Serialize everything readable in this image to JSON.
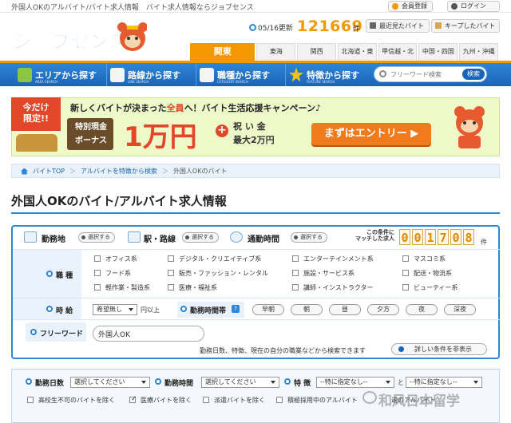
{
  "topbar": {
    "text": "外国人OKのアルバイト/バイト求人情報　バイト求人情報ならジョブセンス",
    "member_register": "会員登録",
    "login": "ログイン"
  },
  "header": {
    "logo_text": "ジョブセンス",
    "update_date": "05/16更新",
    "job_count": "121669",
    "job_count_unit": "件",
    "recent_button": "最近見たバイト",
    "keep_button": "キープしたバイト"
  },
  "regions": [
    "関東",
    "東海",
    "関西",
    "北海道・東北",
    "甲信越・北陸",
    "中国・四国",
    "九州・沖縄"
  ],
  "nav": [
    {
      "label": "エリアから探す",
      "sub": "AREA SEARCH"
    },
    {
      "label": "路線から探す",
      "sub": "LINE SEARCH"
    },
    {
      "label": "職種から探す",
      "sub": "CATEGORY SEARCH"
    },
    {
      "label": "特徴から探す",
      "sub": "FEATURE SEARCH"
    }
  ],
  "search": {
    "placeholder": "フリーワード検索",
    "button": "検索"
  },
  "banner": {
    "badge_line1": "今だけ",
    "badge_line2": "限定!!",
    "title_prefix": "新しくバイトが決まった",
    "title_highlight": "全員",
    "title_suffix": "へ！バイト生活応援キャンペーン♪",
    "bonus_line1": "特別現金",
    "bonus_line2": "ボーナス",
    "amount": "1万円",
    "gift_line1": "祝 い 金",
    "gift_line2": "最大2万円",
    "cta": "まずはエントリー"
  },
  "breadcrumb": [
    "バイトTOP",
    "アルバイトを特徴から検索",
    "外国人OKのバイト"
  ],
  "page_title": "外国人OKのバイト/アルバイト求人情報",
  "conditions": {
    "location_label": "勤務地",
    "station_label": "駅・路線",
    "commute_label": "通勤時間",
    "select_label": "選択する",
    "match_label": "この条件に\nマッチした求人",
    "match_digits": [
      "0",
      "0",
      "1",
      "7",
      "0",
      "8"
    ],
    "match_unit": "件"
  },
  "job_types": {
    "label": "職 種",
    "items": [
      "オフィス系",
      "デジタル・クリエイティブ系",
      "エンターテインメント系",
      "マスコミ系",
      "フード系",
      "販売・ファッション・レンタル",
      "施設・サービス系",
      "配送・物流系",
      "軽作業・製造系",
      "医療・福祉系",
      "講師・インストラクター",
      "ビューティー系"
    ]
  },
  "pay": {
    "label": "時 給",
    "select_value": "希望無し",
    "suffix": "円以上",
    "time_label": "勤務時間帯",
    "help": "?",
    "slots": [
      "早朝",
      "朝",
      "昼",
      "夕方",
      "夜",
      "深夜"
    ]
  },
  "freeword": {
    "label": "フリーワード",
    "value": "外国人OK",
    "hint": "勤務日数、特徴、現在の自分の職業などから検索できます",
    "detail_button": "詳しい条件を非表示"
  },
  "details": {
    "days_label": "勤務日数",
    "days_value": "選択してください",
    "hours_label": "勤務時間",
    "hours_value": "選択してください",
    "feature_label": "特 徴",
    "feature_value1": "--特に指定なし--",
    "and": "と",
    "feature_value2": "--特に指定なし--",
    "checks": [
      "高校生不可のバイトを除く",
      "医療バイトを除く",
      "派遣バイトを除く",
      "積極採用中のアルバイト",
      "週のアルバイト"
    ],
    "checked": [
      false,
      true,
      false,
      false,
      false
    ]
  },
  "watermark": "和风日本留学",
  "colors": {
    "accent": "#f39800",
    "nav_blue": "#1a64b8",
    "banner_red": "#e3472a"
  }
}
